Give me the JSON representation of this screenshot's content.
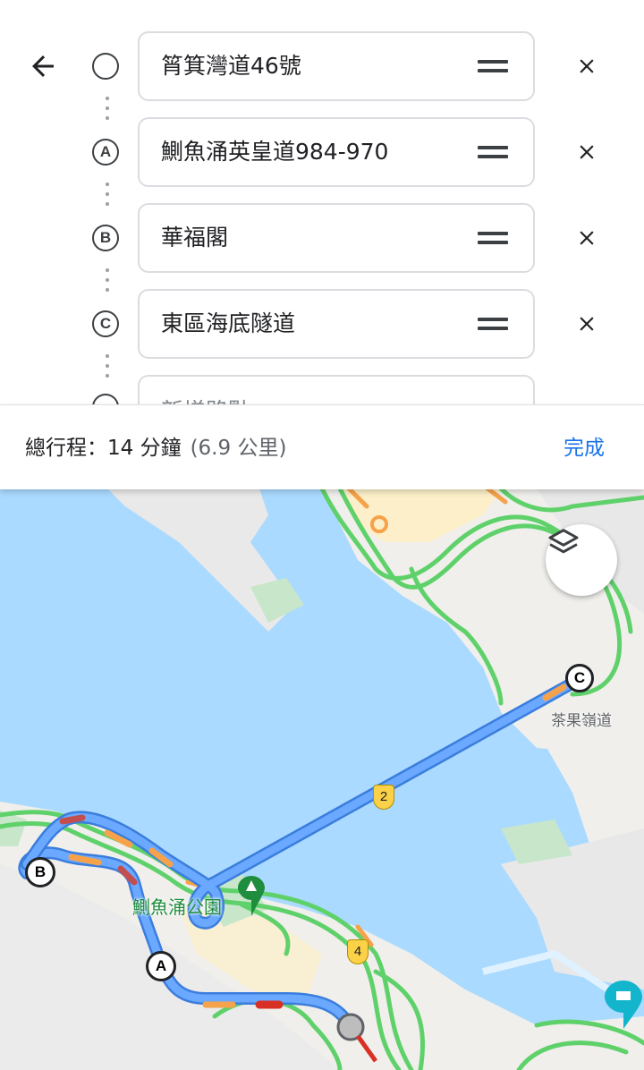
{
  "stops": [
    {
      "marker": "",
      "value": "筲箕灣道46號",
      "placeholder": ""
    },
    {
      "marker": "A",
      "value": "鰂魚涌英皇道984-970",
      "placeholder": ""
    },
    {
      "marker": "B",
      "value": "華福閣",
      "placeholder": ""
    },
    {
      "marker": "C",
      "value": "東區海底隧道",
      "placeholder": ""
    },
    {
      "marker": "",
      "value": "",
      "placeholder": "新增路點"
    }
  ],
  "summary": {
    "total": "總行程：14 分鐘",
    "distance": "(6.9 公里)",
    "done_label": "完成"
  },
  "map": {
    "park_label": "鰂魚涌公園",
    "road_label": "茶果嶺道",
    "shield_2": "2",
    "shield_4": "4",
    "marker_a": "A",
    "marker_b": "B",
    "marker_c": "C"
  },
  "icons": {
    "back": "arrow-left-icon",
    "drag": "drag-handle-icon",
    "remove": "close-icon",
    "layers": "layers-icon"
  },
  "colors": {
    "accent": "#1a73e8",
    "route": "#6aa9ff",
    "traffic_green": "#5fd16a",
    "traffic_orange": "#f6a24a",
    "traffic_red": "#d93025",
    "water": "#aadaff",
    "land": "#f0efec"
  }
}
